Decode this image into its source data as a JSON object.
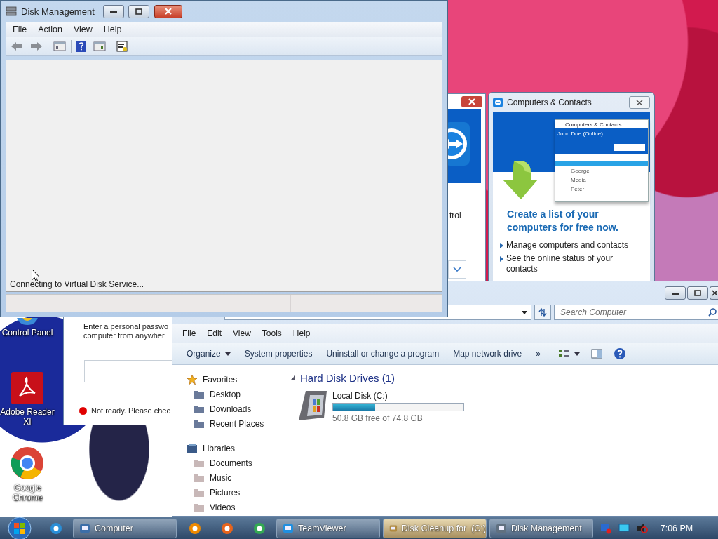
{
  "desktop_icons": [
    {
      "label": "Control Panel"
    },
    {
      "label": "Adobe Reader XI"
    },
    {
      "label": "Google Chrome"
    }
  ],
  "teamviewer_window": {
    "side_text": "trol",
    "prompt_lines": [
      "Enter a personal passwo",
      "computer from anywher"
    ],
    "status": {
      "text": "Not ready. Please chec",
      "color": "#e00000"
    }
  },
  "contacts_window": {
    "title": "Computers & Contacts",
    "preview": {
      "title": "Computers & Contacts",
      "account": "John Doe (Online)",
      "contacts": [
        "George",
        "Media",
        "Peter"
      ]
    },
    "headline": "Create a list of your computers for free now.",
    "bullets": [
      "Manage computers and contacts",
      "See the online status of your contacts"
    ]
  },
  "explorer": {
    "search": {
      "placeholder": "Search Computer"
    },
    "menu": [
      "File",
      "Edit",
      "View",
      "Tools",
      "Help"
    ],
    "commands": [
      {
        "label": "Organize",
        "dropdown": true
      },
      {
        "label": "System properties",
        "dropdown": false
      },
      {
        "label": "Uninstall or change a program",
        "dropdown": false
      },
      {
        "label": "Map network drive",
        "dropdown": false
      }
    ],
    "more": "»",
    "nav": [
      {
        "label": "Favorites",
        "children": [
          {
            "label": "Desktop"
          },
          {
            "label": "Downloads"
          },
          {
            "label": "Recent Places"
          }
        ]
      },
      {
        "label": "Libraries",
        "children": [
          {
            "label": "Documents"
          },
          {
            "label": "Music"
          },
          {
            "label": "Pictures"
          },
          {
            "label": "Videos"
          }
        ]
      }
    ],
    "section": "Hard Disk Drives (1)",
    "drives": [
      {
        "name": "Local Disk (C:)",
        "level": 0.32,
        "free_text": "50.8 GB free of 74.8 GB"
      }
    ]
  },
  "disk_management": {
    "title": "Disk Management",
    "menu": [
      "File",
      "Action",
      "View",
      "Help"
    ],
    "status_message": "Connecting to Virtual Disk Service..."
  },
  "taskbar": {
    "items": [
      {
        "kind": "pinned"
      },
      {
        "kind": "window",
        "label": "Computer",
        "highlighted": false
      },
      {
        "kind": "pinned"
      },
      {
        "kind": "pinned"
      },
      {
        "kind": "pinned"
      },
      {
        "kind": "window",
        "label": "TeamViewer",
        "highlighted": false
      },
      {
        "kind": "window",
        "label": "Disk Cleanup for  (C:)",
        "highlighted": true
      },
      {
        "kind": "window",
        "label": "Disk Management",
        "highlighted": false
      }
    ],
    "clock": "7:06 PM"
  }
}
